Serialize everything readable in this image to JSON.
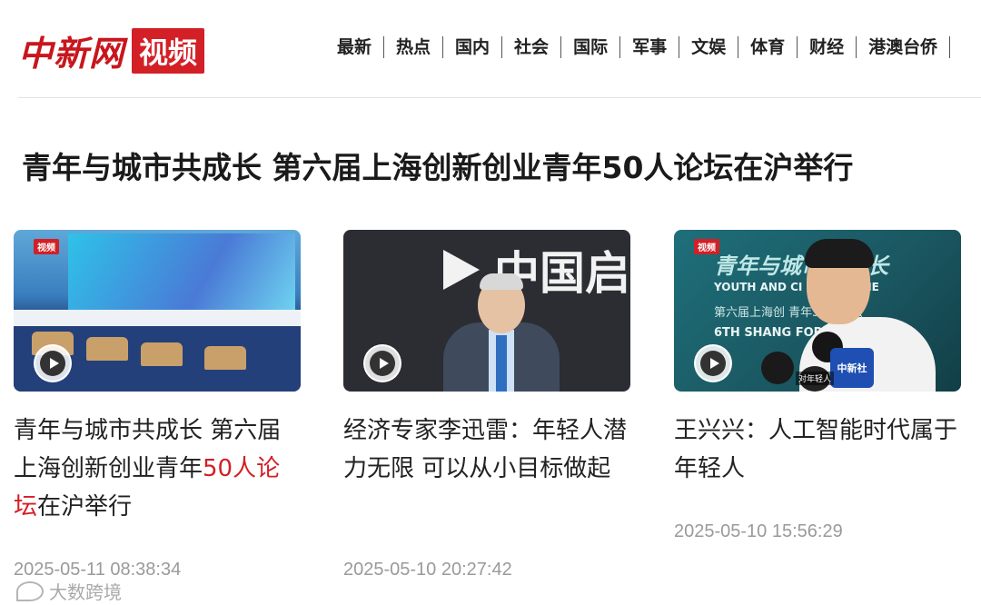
{
  "logo": {
    "name": "中新网",
    "tag": "视频"
  },
  "nav": [
    "最新",
    "热点",
    "国内",
    "社会",
    "国际",
    "军事",
    "文娱",
    "体育",
    "财经",
    "港澳台侨"
  ],
  "headline": "青年与城市共成长 第六届上海创新创业青年50人论坛在沪举行",
  "cards": [
    {
      "title_a": "青年与城市共成长 第六届上海创新创业青年",
      "title_hl": "50人论坛",
      "title_b": "在沪举行",
      "time": "2025-05-11 08:38:34",
      "badge": "视频"
    },
    {
      "title": "经济专家李迅雷：年轻人潜力无限 可以从小目标做起",
      "time": "2025-05-10 20:27:42",
      "banner": "中国启"
    },
    {
      "title": "王兴兴：人工智能时代属于年轻人",
      "time": "2025-05-10 15:56:29",
      "badge": "视频",
      "banner": "青年与城市共成长",
      "banner_en": "YOUTH AND CI    W TOGETHE",
      "banner_sub": "第六届上海创     青年50人论坛",
      "banner_en2": "6TH SHANG    FORU",
      "mic_label": "中新社",
      "caption": "对年轻人"
    }
  ],
  "watermark": "大数跨境",
  "colors": {
    "brand_red": "#d31f26",
    "time_gray": "#9a9a9a"
  }
}
